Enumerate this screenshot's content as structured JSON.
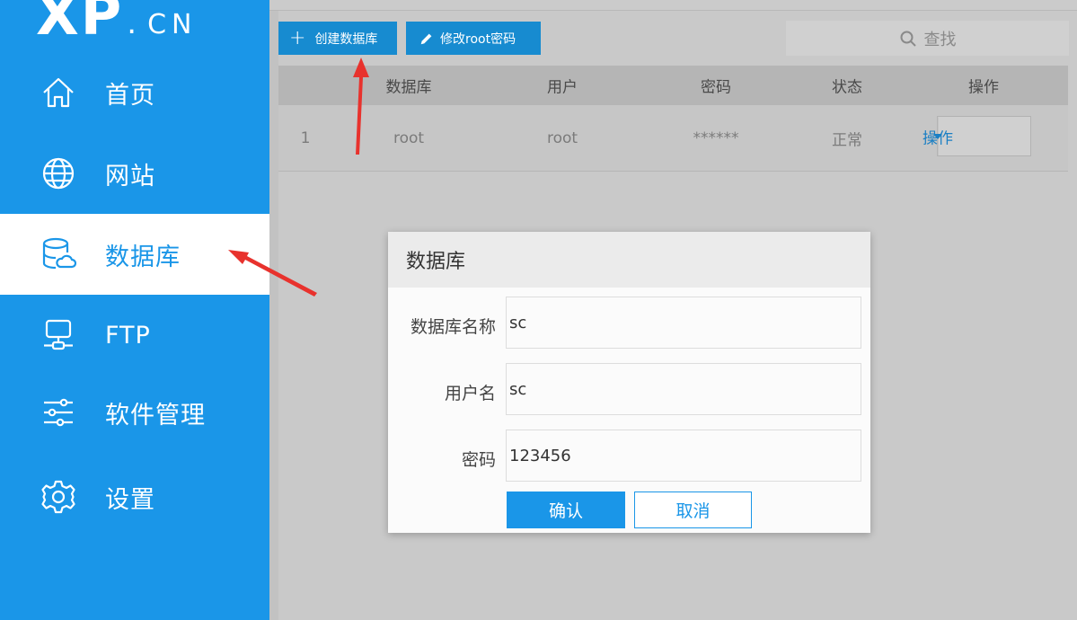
{
  "logo": {
    "main": "XP",
    "sub": "CN"
  },
  "sidebar": {
    "items": [
      {
        "label": "首页",
        "icon": "home-icon",
        "active": false
      },
      {
        "label": "网站",
        "icon": "globe-icon",
        "active": false
      },
      {
        "label": "数据库",
        "icon": "database-icon",
        "active": true
      },
      {
        "label": "FTP",
        "icon": "ftp-server-icon",
        "active": false
      },
      {
        "label": "软件管理",
        "icon": "sliders-icon",
        "active": false
      },
      {
        "label": "设置",
        "icon": "gear-icon",
        "active": false
      }
    ]
  },
  "toolbar": {
    "create_label": "创建数据库",
    "root_pwd_label": "修改root密码",
    "search_placeholder": "查找"
  },
  "table": {
    "headers": [
      "数据库",
      "用户",
      "密码",
      "状态",
      "操作"
    ],
    "rows": [
      {
        "index": "1",
        "database": "root",
        "user": "root",
        "password": "******",
        "status": "正常",
        "action": "操作"
      }
    ]
  },
  "modal": {
    "title": "数据库",
    "fields": [
      {
        "label": "数据库名称",
        "value": "sc"
      },
      {
        "label": "用户名",
        "value": "sc"
      },
      {
        "label": "密码",
        "value": "123456"
      }
    ],
    "confirm_label": "确认",
    "cancel_label": "取消"
  },
  "colors": {
    "primary": "#1a96e8",
    "annotation_arrow": "#e8322d"
  }
}
